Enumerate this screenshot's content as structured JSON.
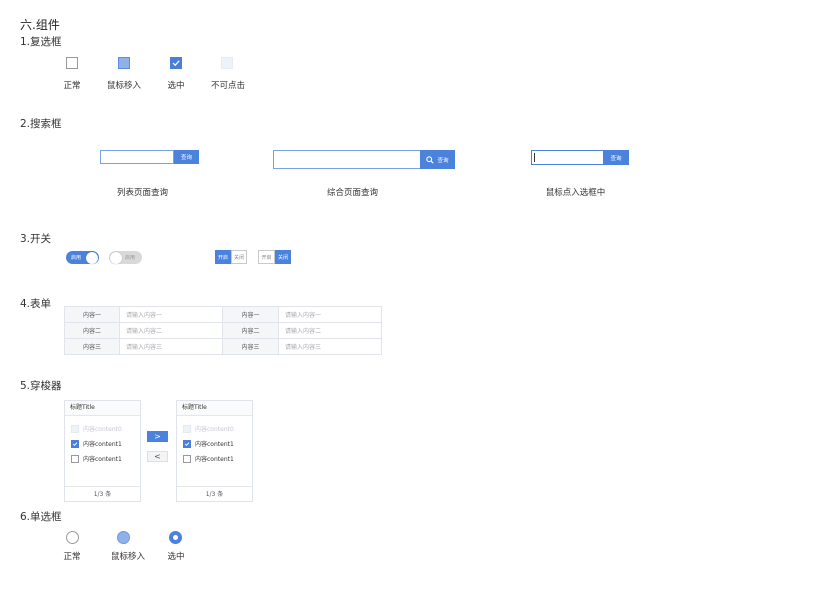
{
  "page_title": "六.组件",
  "colors": {
    "primary": "#4a82dc",
    "hover": "#8fb1ea",
    "border": "#9a9a9a",
    "disabled": "#eef2fa"
  },
  "checkbox": {
    "title": "1.复选框",
    "states": [
      "正常",
      "鼠标移入",
      "选中",
      "不可点击"
    ]
  },
  "search": {
    "title": "2.搜索框",
    "button_label": "查询",
    "captions": [
      "列表页面查询",
      "综合页面查询",
      "鼠标点入选框中"
    ],
    "icon": "search-icon"
  },
  "switch": {
    "title": "3.开关",
    "on_label": "启用",
    "off_label": "启用",
    "seg_open": "开启",
    "seg_close": "关闭"
  },
  "form": {
    "title": "4.表单",
    "rows": [
      {
        "key": "内容一",
        "placeholder": "请输入内容一"
      },
      {
        "key": "内容二",
        "placeholder": "请输入内容二"
      },
      {
        "key": "内容三",
        "placeholder": "请输入内容三"
      }
    ]
  },
  "transfer": {
    "title": "5.穿梭器",
    "panel_title": "标题Title",
    "items": [
      "内容content0",
      "内容content1",
      "内容content1"
    ],
    "footer": "1/3 条",
    "btn_right": ">",
    "btn_left": "<"
  },
  "radio": {
    "title": "6.单选框",
    "states": [
      "正常",
      "鼠标移入",
      "选中"
    ]
  }
}
